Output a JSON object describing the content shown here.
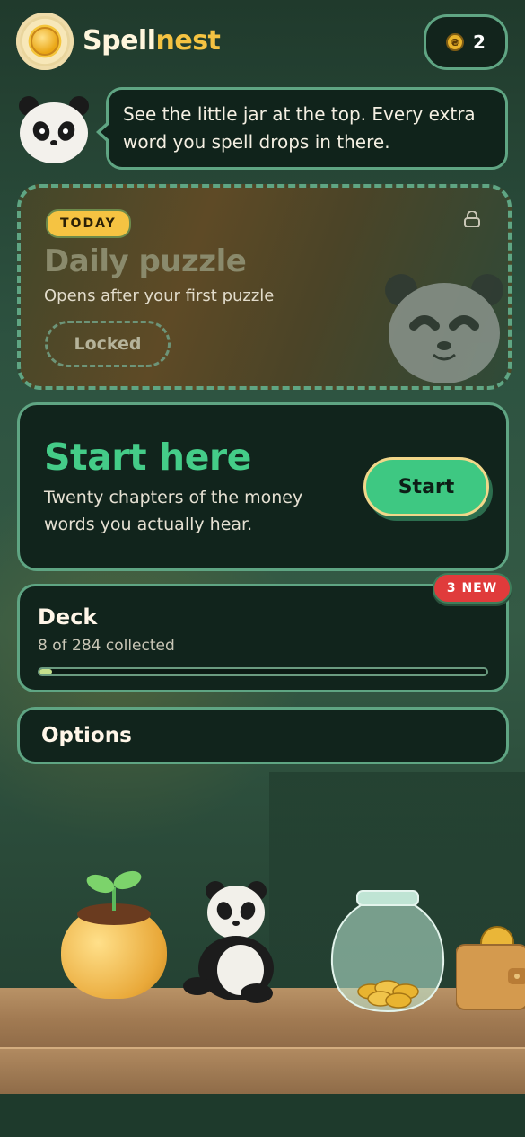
{
  "header": {
    "brand_part1": "Spell",
    "brand_part2": "nest",
    "coin_count": "2",
    "icons": [
      "logo-icon",
      "coin-icon"
    ]
  },
  "mascot": {
    "message": "See the little jar at the top. Every extra word you spell drops in there."
  },
  "daily": {
    "badge": "TODAY",
    "title": "Daily puzzle",
    "subtitle": "Opens after your first puzzle",
    "status": "Locked",
    "icons": [
      "lock-icon"
    ]
  },
  "start": {
    "title": "Start here",
    "description": "Twenty chapters of the money words you actually hear.",
    "button": "Start"
  },
  "deck": {
    "title": "Deck",
    "collected": "8 of 284 collected",
    "progress": 0.028,
    "new_badge": "3 NEW"
  },
  "options": {
    "label": "Options"
  },
  "colors": {
    "accent_green": "#44cc88",
    "border_green": "#5fa583",
    "gold": "#f5c342",
    "badge_red": "#e03b3b"
  }
}
